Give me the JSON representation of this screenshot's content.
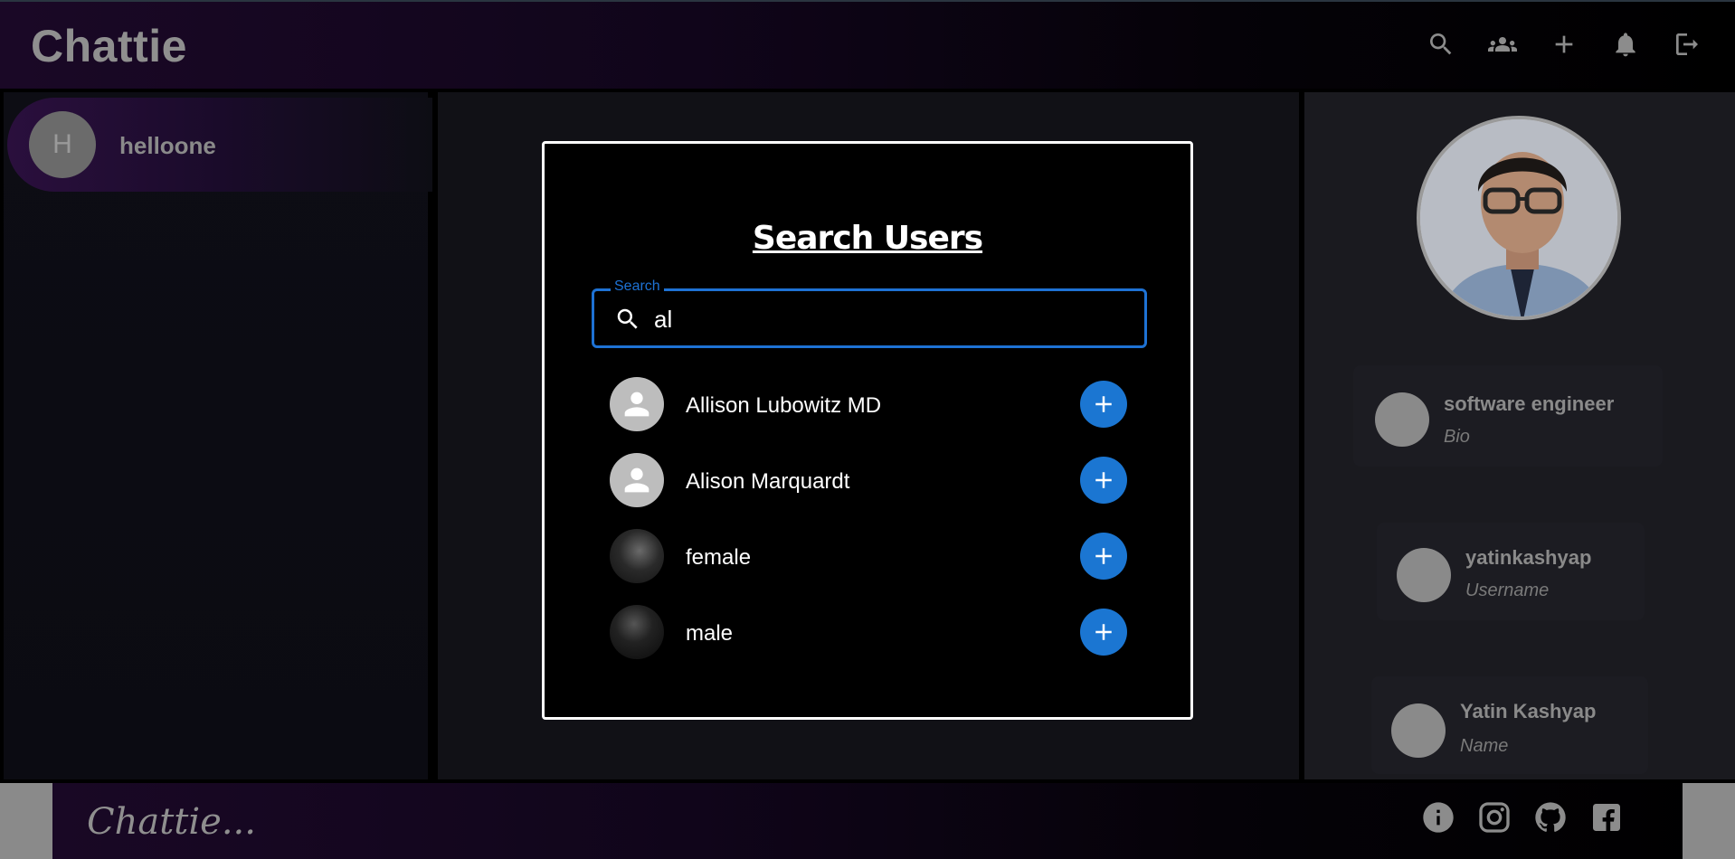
{
  "header": {
    "brand": "Chattie"
  },
  "top_icons": [
    "search-icon",
    "group-icon",
    "plus-icon",
    "bell-icon",
    "logout-icon"
  ],
  "sidebar": {
    "chats": [
      {
        "initial": "H",
        "name": "helloone"
      }
    ]
  },
  "modal": {
    "title": "Search Users",
    "search": {
      "legend": "Search",
      "value": "al"
    },
    "results": [
      {
        "name": "Allison Lubowitz MD",
        "avatar": "default-avatar"
      },
      {
        "name": "Alison Marquardt",
        "avatar": "default-avatar"
      },
      {
        "name": "female",
        "avatar": "photo"
      },
      {
        "name": "male",
        "avatar": "photo"
      }
    ]
  },
  "profile": {
    "bio": {
      "value": "software engineer",
      "label": "Bio"
    },
    "username": {
      "value": "yatinkashyap",
      "label": "Username"
    },
    "name": {
      "value": "Yatin Kashyap",
      "label": "Name"
    }
  },
  "footer": {
    "brand": "Chattie..."
  },
  "footer_icons": [
    "info-icon",
    "instagram-icon",
    "github-icon",
    "facebook-icon"
  ],
  "colors": {
    "accent": "#1b76d2",
    "focus": "#1e72d4",
    "brand_gradient": "#1a0826"
  }
}
